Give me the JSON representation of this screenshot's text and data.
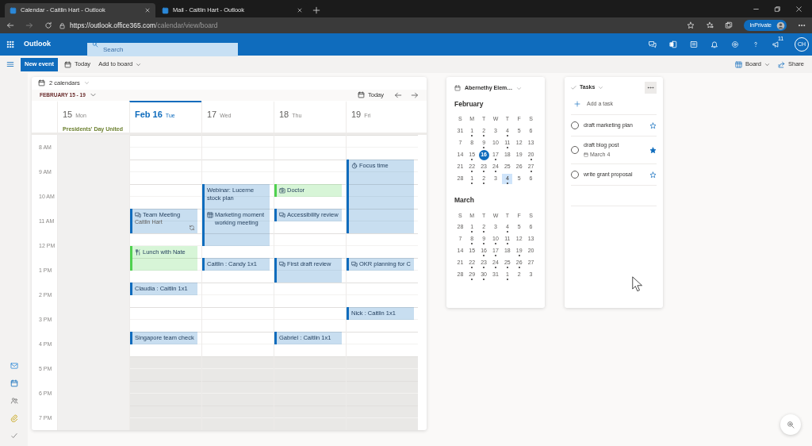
{
  "browser": {
    "tabs": [
      {
        "title": "Calendar - Caitlin Hart - Outlook",
        "selected": true
      },
      {
        "title": "Mail - Caitlin Hart - Outlook",
        "selected": false
      }
    ],
    "url_host": "https://outlook.office365.com",
    "url_path": "/calendar/view/board",
    "inprivate_label": "InPrivate"
  },
  "app_bar": {
    "app_name": "Outlook",
    "search_placeholder": "Search",
    "badge_count": "11",
    "avatar_initials": "CH"
  },
  "toolbar": {
    "new_event": "New event",
    "today": "Today",
    "add_to_board": "Add to board",
    "board": "Board",
    "share": "Share"
  },
  "calendar_card": {
    "calendars_label": "2 calendars",
    "range_label": "FEBRUARY 15 - 19",
    "today_button": "Today",
    "hours": [
      {
        "label": "8 AM",
        "working": true
      },
      {
        "label": "9 AM",
        "working": true
      },
      {
        "label": "10 AM",
        "working": true
      },
      {
        "label": "11 AM",
        "working": true
      },
      {
        "label": "12 PM",
        "working": true
      },
      {
        "label": "1 PM",
        "working": true
      },
      {
        "label": "2 PM",
        "working": true
      },
      {
        "label": "3 PM",
        "working": true
      },
      {
        "label": "4 PM",
        "working": true
      },
      {
        "label": "5 PM",
        "working": false
      },
      {
        "label": "6 PM",
        "working": false
      },
      {
        "label": "7 PM",
        "working": false
      }
    ],
    "days": [
      {
        "number": "15",
        "weekday": "Mon",
        "today": false,
        "working": false,
        "holiday": "Presidents' Day United"
      },
      {
        "number": "Feb 16",
        "weekday": "Tue",
        "today": true,
        "working": true,
        "slots": [
          {
            "kind": "free"
          },
          {
            "kind": "free"
          },
          {
            "kind": "free"
          },
          {
            "kind": "free"
          },
          {
            "kind": "free"
          },
          {
            "kind": "free"
          },
          {
            "kind": "meeting",
            "title": "Team Meeting",
            "subtitle": "Caitlin Hart",
            "color": "#0f6cbd",
            "recurring": true
          },
          {
            "kind": "continued"
          },
          {
            "kind": "free"
          },
          {
            "kind": "meal",
            "title": "Lunch with Nate",
            "color": "#4fd14f",
            "recurring": false
          },
          {
            "kind": "continued"
          },
          {
            "kind": "free"
          },
          {
            "kind": "plain",
            "title": "Claudia : Caitlin 1x1",
            "color": "#0f6cbd",
            "recurring": false
          },
          {
            "kind": "free"
          },
          {
            "kind": "free"
          },
          {
            "kind": "free"
          },
          {
            "kind": "plain",
            "title": "Singapore team check",
            "color": "#0f6cbd",
            "recurring": false
          }
        ]
      },
      {
        "number": "17",
        "weekday": "Wed",
        "today": false,
        "working": true,
        "slots": [
          {
            "kind": "free"
          },
          {
            "kind": "free"
          },
          {
            "kind": "free"
          },
          {
            "kind": "free"
          },
          {
            "kind": "plain",
            "title": "Webinar: Lucerne stock plan",
            "color": "#0f6cbd",
            "recurring": false
          },
          {
            "kind": "continued"
          },
          {
            "kind": "board",
            "title": "Marketing moment working meeting",
            "color": "#0f6cbd",
            "recurring": false
          },
          {
            "kind": "continued"
          },
          {
            "kind": "continued"
          },
          {
            "kind": "free"
          },
          {
            "kind": "plain",
            "title": "Caitlin : Candy 1x1",
            "color": "#0f6cbd",
            "recurring": false
          }
        ]
      },
      {
        "number": "18",
        "weekday": "Thu",
        "today": false,
        "working": true,
        "slots": [
          {
            "kind": "free"
          },
          {
            "kind": "free"
          },
          {
            "kind": "free"
          },
          {
            "kind": "free"
          },
          {
            "kind": "appointment",
            "title": "Doctor",
            "color": "#4fd14f",
            "recurring": false
          },
          {
            "kind": "free"
          },
          {
            "kind": "meeting",
            "title": "Accessibility review",
            "color": "#0f6cbd",
            "recurring": false
          },
          {
            "kind": "free"
          },
          {
            "kind": "free"
          },
          {
            "kind": "free"
          },
          {
            "kind": "meeting",
            "title": "First draft review",
            "color": "#0f6cbd",
            "recurring": false
          },
          {
            "kind": "continued"
          },
          {
            "kind": "free"
          },
          {
            "kind": "free"
          },
          {
            "kind": "free"
          },
          {
            "kind": "free"
          },
          {
            "kind": "plain",
            "title": "Gabriel : Caitlin 1x1",
            "color": "#0f6cbd",
            "recurring": false
          }
        ]
      },
      {
        "number": "19",
        "weekday": "Fri",
        "today": false,
        "working": true,
        "slots": [
          {
            "kind": "free"
          },
          {
            "kind": "free"
          },
          {
            "kind": "focus",
            "title": "Focus time",
            "color": "#0f6cbd",
            "recurring": false
          },
          {
            "kind": "continued"
          },
          {
            "kind": "continued"
          },
          {
            "kind": "continued"
          },
          {
            "kind": "continued"
          },
          {
            "kind": "continued"
          },
          {
            "kind": "free"
          },
          {
            "kind": "free"
          },
          {
            "kind": "meeting",
            "title": "OKR planning for C",
            "color": "#0f6cbd",
            "recurring": false
          },
          {
            "kind": "free"
          },
          {
            "kind": "free"
          },
          {
            "kind": "free"
          },
          {
            "kind": "plain",
            "title": "Nick : Caitlin 1x1",
            "color": "#0f6cbd",
            "recurring": false
          }
        ]
      }
    ]
  },
  "mini_calendar": {
    "title": "Abernethy Elem…",
    "months": [
      {
        "name": "February",
        "weekday_labels": [
          "S",
          "M",
          "T",
          "W",
          "T",
          "F",
          "S"
        ],
        "weeks": [
          [
            {
              "d": "31",
              "dot": false,
              "selected": false,
              "highlighted": false
            },
            {
              "d": "1",
              "dot": true,
              "selected": false,
              "highlighted": false
            },
            {
              "d": "2",
              "dot": true,
              "selected": false,
              "highlighted": false
            },
            {
              "d": "3",
              "dot": false,
              "selected": false,
              "highlighted": false
            },
            {
              "d": "4",
              "dot": true,
              "selected": false,
              "highlighted": false
            },
            {
              "d": "5",
              "dot": false,
              "selected": false,
              "highlighted": false
            },
            {
              "d": "6",
              "dot": false,
              "selected": false,
              "highlighted": false
            }
          ],
          [
            {
              "d": "7",
              "dot": false,
              "selected": false,
              "highlighted": false
            },
            {
              "d": "8",
              "dot": false,
              "selected": false,
              "highlighted": false
            },
            {
              "d": "9",
              "dot": true,
              "selected": false,
              "highlighted": false
            },
            {
              "d": "10",
              "dot": false,
              "selected": false,
              "highlighted": false
            },
            {
              "d": "11",
              "dot": true,
              "selected": false,
              "highlighted": false
            },
            {
              "d": "12",
              "dot": false,
              "selected": false,
              "highlighted": false
            },
            {
              "d": "13",
              "dot": false,
              "selected": false,
              "highlighted": false
            }
          ],
          [
            {
              "d": "14",
              "dot": false,
              "selected": false,
              "highlighted": false
            },
            {
              "d": "15",
              "dot": true,
              "selected": false,
              "highlighted": false
            },
            {
              "d": "16",
              "dot": false,
              "selected": true,
              "highlighted": false
            },
            {
              "d": "17",
              "dot": true,
              "selected": false,
              "highlighted": false
            },
            {
              "d": "18",
              "dot": false,
              "selected": false,
              "highlighted": false
            },
            {
              "d": "19",
              "dot": false,
              "selected": false,
              "highlighted": false
            },
            {
              "d": "20",
              "dot": true,
              "selected": false,
              "highlighted": false
            }
          ],
          [
            {
              "d": "21",
              "dot": false,
              "selected": false,
              "highlighted": false
            },
            {
              "d": "22",
              "dot": true,
              "selected": false,
              "highlighted": false
            },
            {
              "d": "23",
              "dot": true,
              "selected": false,
              "highlighted": false
            },
            {
              "d": "24",
              "dot": true,
              "selected": false,
              "highlighted": false
            },
            {
              "d": "25",
              "dot": false,
              "selected": false,
              "highlighted": false
            },
            {
              "d": "26",
              "dot": false,
              "selected": false,
              "highlighted": false
            },
            {
              "d": "27",
              "dot": true,
              "selected": false,
              "highlighted": false
            }
          ],
          [
            {
              "d": "28",
              "dot": false,
              "selected": false,
              "highlighted": false
            },
            {
              "d": "1",
              "dot": true,
              "selected": false,
              "highlighted": false
            },
            {
              "d": "2",
              "dot": true,
              "selected": false,
              "highlighted": false
            },
            {
              "d": "3",
              "dot": false,
              "selected": false,
              "highlighted": false
            },
            {
              "d": "4",
              "dot": true,
              "selected": false,
              "highlighted": true
            },
            {
              "d": "5",
              "dot": false,
              "selected": false,
              "highlighted": false
            },
            {
              "d": "6",
              "dot": false,
              "selected": false,
              "highlighted": false
            }
          ]
        ]
      },
      {
        "name": "March",
        "weekday_labels": [
          "S",
          "M",
          "T",
          "W",
          "T",
          "F",
          "S"
        ],
        "weeks": [
          [
            {
              "d": "28",
              "dot": false,
              "selected": false,
              "highlighted": false
            },
            {
              "d": "1",
              "dot": true,
              "selected": false,
              "highlighted": false
            },
            {
              "d": "2",
              "dot": true,
              "selected": false,
              "highlighted": false
            },
            {
              "d": "3",
              "dot": false,
              "selected": false,
              "highlighted": false
            },
            {
              "d": "4",
              "dot": true,
              "selected": false,
              "highlighted": false
            },
            {
              "d": "5",
              "dot": false,
              "selected": false,
              "highlighted": false
            },
            {
              "d": "6",
              "dot": false,
              "selected": false,
              "highlighted": false
            }
          ],
          [
            {
              "d": "7",
              "dot": false,
              "selected": false,
              "highlighted": false
            },
            {
              "d": "8",
              "dot": true,
              "selected": false,
              "highlighted": false
            },
            {
              "d": "9",
              "dot": true,
              "selected": false,
              "highlighted": false
            },
            {
              "d": "10",
              "dot": true,
              "selected": false,
              "highlighted": false
            },
            {
              "d": "11",
              "dot": true,
              "selected": false,
              "highlighted": false
            },
            {
              "d": "12",
              "dot": false,
              "selected": false,
              "highlighted": false
            },
            {
              "d": "13",
              "dot": false,
              "selected": false,
              "highlighted": false
            }
          ],
          [
            {
              "d": "14",
              "dot": false,
              "selected": false,
              "highlighted": false
            },
            {
              "d": "15",
              "dot": false,
              "selected": false,
              "highlighted": false
            },
            {
              "d": "16",
              "dot": true,
              "selected": false,
              "highlighted": false
            },
            {
              "d": "17",
              "dot": true,
              "selected": false,
              "highlighted": false
            },
            {
              "d": "18",
              "dot": false,
              "selected": false,
              "highlighted": false
            },
            {
              "d": "19",
              "dot": true,
              "selected": false,
              "highlighted": false
            },
            {
              "d": "20",
              "dot": false,
              "selected": false,
              "highlighted": false
            }
          ],
          [
            {
              "d": "21",
              "dot": false,
              "selected": false,
              "highlighted": false
            },
            {
              "d": "22",
              "dot": true,
              "selected": false,
              "highlighted": false
            },
            {
              "d": "23",
              "dot": true,
              "selected": false,
              "highlighted": false
            },
            {
              "d": "24",
              "dot": true,
              "selected": false,
              "highlighted": false
            },
            {
              "d": "25",
              "dot": true,
              "selected": false,
              "highlighted": false
            },
            {
              "d": "26",
              "dot": true,
              "selected": false,
              "highlighted": false
            },
            {
              "d": "27",
              "dot": false,
              "selected": false,
              "highlighted": false
            }
          ],
          [
            {
              "d": "28",
              "dot": false,
              "selected": false,
              "highlighted": false
            },
            {
              "d": "29",
              "dot": true,
              "selected": false,
              "highlighted": false
            },
            {
              "d": "30",
              "dot": true,
              "selected": false,
              "highlighted": false
            },
            {
              "d": "31",
              "dot": false,
              "selected": false,
              "highlighted": false
            },
            {
              "d": "1",
              "dot": true,
              "selected": false,
              "highlighted": false
            },
            {
              "d": "2",
              "dot": false,
              "selected": false,
              "highlighted": false
            },
            {
              "d": "3",
              "dot": false,
              "selected": false,
              "highlighted": false
            }
          ]
        ]
      }
    ]
  },
  "tasks": {
    "title": "Tasks",
    "add_task": "Add a task",
    "items": [
      {
        "title": "draft marketing plan",
        "completed": false,
        "important": false
      },
      {
        "title": "draft blog post",
        "due": "March 4",
        "completed": false,
        "important": true
      },
      {
        "title": "write grant proposal",
        "completed": false,
        "important": false
      }
    ]
  }
}
